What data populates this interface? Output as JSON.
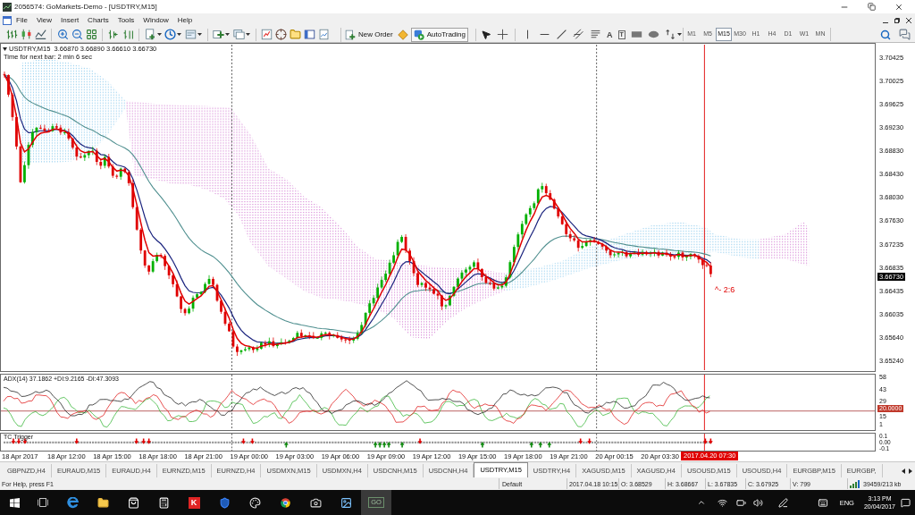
{
  "window": {
    "title": "2056574: GoMarkets-Demo - [USDTRY,M15]"
  },
  "menu": [
    "File",
    "View",
    "Insert",
    "Charts",
    "Tools",
    "Window",
    "Help"
  ],
  "toolbar": {
    "new_order": "New Order",
    "auto_trading": "AutoTrading",
    "text_tool": "A",
    "label_tool": "T",
    "timeframes": [
      {
        "label": "M1",
        "selected": false
      },
      {
        "label": "M5",
        "selected": false
      },
      {
        "label": "M15",
        "selected": true
      },
      {
        "label": "M30",
        "selected": false
      },
      {
        "label": "H1",
        "selected": false
      },
      {
        "label": "H4",
        "selected": false
      },
      {
        "label": "D1",
        "selected": false
      },
      {
        "label": "W1",
        "selected": false
      },
      {
        "label": "MN",
        "selected": false
      }
    ]
  },
  "chart": {
    "symbol_info": "USDTRY,M15  3.66870 3.66890 3.66610 3.66730",
    "timer": "Time for next bar: 2 min 6 sec",
    "annotation": "^- 2:6",
    "price_axis": [
      "3.70425",
      "3.70025",
      "3.69625",
      "3.69230",
      "3.68830",
      "3.68430",
      "3.68030",
      "3.67630",
      "3.67235",
      "3.66835",
      "3.66435",
      "3.66035",
      "3.65640",
      "3.65240"
    ],
    "current_price": "3.66730",
    "time_axis": [
      "18 Apr 2017",
      "18 Apr 12:00",
      "18 Apr 15:00",
      "18 Apr 18:00",
      "18 Apr 21:00",
      "19 Apr 00:00",
      "19 Apr 03:00",
      "19 Apr 06:00",
      "19 Apr 09:00",
      "19 Apr 12:00",
      "19 Apr 15:00",
      "19 Apr 18:00",
      "19 Apr 21:00",
      "20 Apr 00:15",
      "20 Apr 03:30"
    ],
    "cursor_time": "2017.04.20 07:30"
  },
  "adx": {
    "label": "ADX(14) 37.1862 +DI:9.2165 -DI:47.3093",
    "axis": [
      "58",
      "43",
      "29",
      "15",
      "1"
    ],
    "level_label": "20.0000"
  },
  "trigger": {
    "label": "TC Trigger",
    "axis": [
      "0.1",
      "0.00",
      "-0.1"
    ]
  },
  "tabs": [
    {
      "label": "GBPNZD,H4",
      "selected": false
    },
    {
      "label": "EURAUD,M15",
      "selected": false
    },
    {
      "label": "EURAUD,H4",
      "selected": false
    },
    {
      "label": "EURNZD,M15",
      "selected": false
    },
    {
      "label": "EURNZD,H4",
      "selected": false
    },
    {
      "label": "USDMXN,M15",
      "selected": false
    },
    {
      "label": "USDMXN,H4",
      "selected": false
    },
    {
      "label": "USDCNH,M15",
      "selected": false
    },
    {
      "label": "USDCNH,H4",
      "selected": false
    },
    {
      "label": "USDTRY,M15",
      "selected": true
    },
    {
      "label": "USDTRY,H4",
      "selected": false
    },
    {
      "label": "XAGUSD,M15",
      "selected": false
    },
    {
      "label": "XAGUSD,H4",
      "selected": false
    },
    {
      "label": "USOUSD,M15",
      "selected": false
    },
    {
      "label": "USOUSD,H4",
      "selected": false
    },
    {
      "label": "EURGBP,M15",
      "selected": false
    },
    {
      "label": "EURGBP,",
      "selected": false
    }
  ],
  "status_bar": {
    "help": "For Help, press F1",
    "profile": "Default",
    "datetime": "2017.04.18 10:15",
    "open": "O: 3.68529",
    "high": "H: 3.68667",
    "low": "L: 3.67835",
    "close": "C: 3.67925",
    "volume": "V: 799",
    "traffic": "39459/213 kb"
  },
  "taskbar": {
    "apps": [
      {
        "kind": "start",
        "selected": false
      },
      {
        "kind": "task_view",
        "selected": false
      },
      {
        "kind": "browser_e",
        "selected": false
      },
      {
        "kind": "folder",
        "selected": false
      },
      {
        "kind": "store",
        "selected": false
      },
      {
        "kind": "calculator",
        "selected": false
      },
      {
        "kind": "letter_tile",
        "label": "K",
        "selected": false
      },
      {
        "kind": "shield",
        "selected": false
      },
      {
        "kind": "paint",
        "selected": false
      },
      {
        "kind": "browser_ball",
        "selected": false
      },
      {
        "kind": "camera",
        "selected": false
      },
      {
        "kind": "photos",
        "selected": false
      },
      {
        "kind": "letter_app",
        "label": "GO",
        "selected": true
      }
    ],
    "language": "ENG",
    "time": "3:13 PM",
    "date": "20/04/2017"
  }
}
